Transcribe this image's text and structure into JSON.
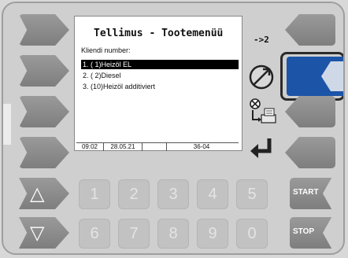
{
  "screen": {
    "title": "Tellimus - Tootemenüü",
    "subtitle": "Kliendi number:",
    "page_indicator": "->2",
    "items": [
      {
        "label": "1.  ( 1)Heizöl EL"
      },
      {
        "label": "2.  ( 2)Diesel"
      },
      {
        "label": "3.  (10)Heizöl additiviert"
      }
    ],
    "status": {
      "time": "09:02",
      "date": "28.05.21",
      "blank1": "",
      "code": "36-04"
    }
  },
  "icons": {
    "cancel": "cancel-circle-icon",
    "print": "print-icon",
    "enter": "enter-icon"
  },
  "keypad": {
    "row1": [
      "1",
      "2",
      "3",
      "4",
      "5"
    ],
    "row2": [
      "6",
      "7",
      "8",
      "9",
      "0"
    ]
  },
  "buttons": {
    "up": "△",
    "down": "▽",
    "start": "START",
    "stop": "STOP"
  },
  "colors": {
    "active_button": "#1c54a8",
    "selection": "#000000"
  }
}
